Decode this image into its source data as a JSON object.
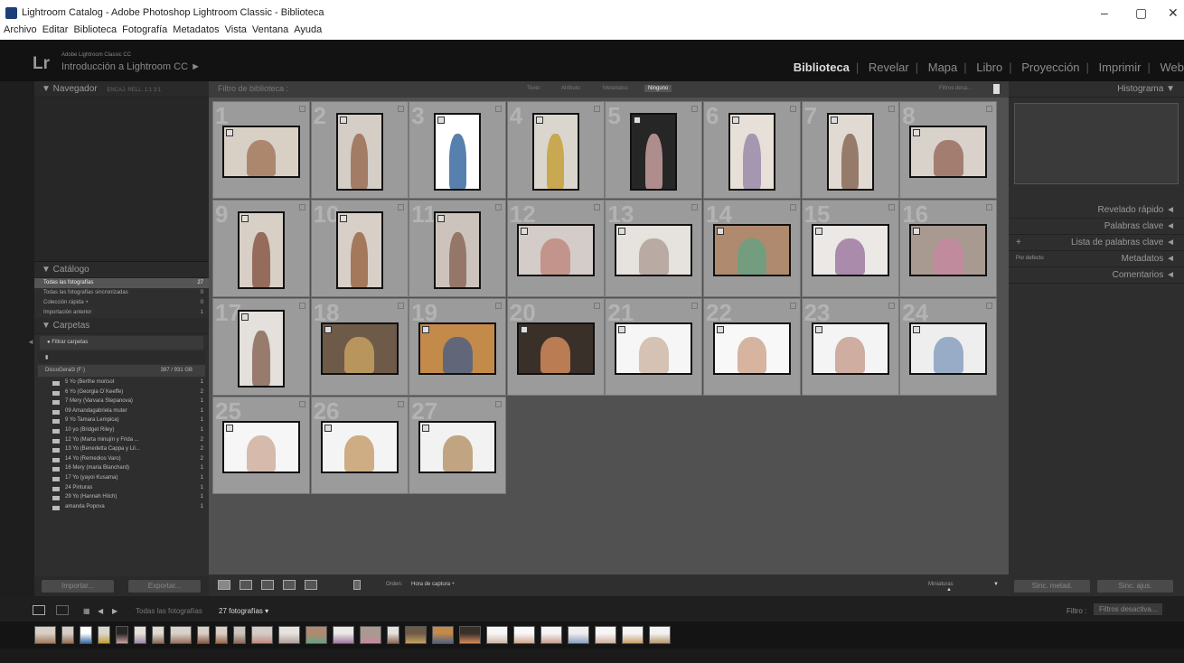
{
  "window": {
    "title": "Lightroom Catalog - Adobe Photoshop Lightroom Classic - Biblioteca",
    "min": "–",
    "max": "▢",
    "close": "✕"
  },
  "menu": [
    "Archivo",
    "Editar",
    "Biblioteca",
    "Fotografía",
    "Metadatos",
    "Vista",
    "Ventana",
    "Ayuda"
  ],
  "identity": {
    "logo": "Lr",
    "product_small": "Adobe Lightroom Classic CC",
    "product": "Introducción a Lightroom CC ►"
  },
  "modules": [
    "Biblioteca",
    "Revelar",
    "Mapa",
    "Libro",
    "Proyección",
    "Imprimir",
    "Web"
  ],
  "left": {
    "navigator": "▼ Navegador",
    "navigator_opts": "ENCAJ.  RELL.  1:1  3:1",
    "catalog": "▼ Catálogo",
    "catalog_items": [
      {
        "label": "Todas las fotografías",
        "count": "27"
      },
      {
        "label": "Todas las fotografías sincronizadas",
        "count": "0"
      },
      {
        "label": "Colección rápida +",
        "count": "0"
      },
      {
        "label": "Importación anterior",
        "count": "1"
      }
    ],
    "folders": "▼ Carpetas",
    "filter_folders": "Filtrar carpetas",
    "volume": "DiscoGeral3 (F:)",
    "volume_size": "387 / 931 GB",
    "folder_items": [
      {
        "label": "5 Yo (Berthe morisot",
        "count": "1"
      },
      {
        "label": "6 Yo (Georgia O´Keeffe)",
        "count": "2"
      },
      {
        "label": "7 Mery (Varvara Stepanova)",
        "count": "1"
      },
      {
        "label": "09 Amandagabriela muter",
        "count": "1"
      },
      {
        "label": "9 Yo Tamara Lempica)",
        "count": "1"
      },
      {
        "label": "10 yo (Bridget Riley)",
        "count": "1"
      },
      {
        "label": "12 Yo (Marta minujín y Frida ...",
        "count": "2"
      },
      {
        "label": "13 Yo (Benedetta Cappa y Lil...",
        "count": "2"
      },
      {
        "label": "14 Yo (Remedios Varo)",
        "count": "2"
      },
      {
        "label": "16 Mery (maria Blanchard)",
        "count": "1"
      },
      {
        "label": "17 Yo (yayoi Kusama)",
        "count": "1"
      },
      {
        "label": "24 Pinturas",
        "count": "1"
      },
      {
        "label": "29 Yo (Hannah Höch)",
        "count": "1"
      },
      {
        "label": "amanda Popova",
        "count": "1"
      }
    ],
    "import_btn": "Importar...",
    "export_btn": "Exportar..."
  },
  "filter": {
    "title": "Filtro de biblioteca :",
    "texto": "Texto",
    "atributo": "Atributo",
    "metadatos": "Metadatos",
    "ninguno": "Ninguno",
    "preset": "Filtros desa..."
  },
  "grid": {
    "numbers": [
      "1",
      "2",
      "3",
      "4",
      "5",
      "6",
      "7",
      "8",
      "9",
      "10",
      "11",
      "12",
      "13",
      "14",
      "15",
      "16",
      "17",
      "18",
      "19",
      "20",
      "21",
      "22",
      "23",
      "24",
      "25",
      "26",
      "27"
    ]
  },
  "toolbar": {
    "orden_label": "Orden:",
    "orden_value": "Hora de captura ÷",
    "miniaturas": "Miniaturas"
  },
  "right": {
    "histograma": "Histograma ▼",
    "panels": [
      "Revelado rápido ◄",
      "Palabras clave ◄",
      "Lista de palabras clave ◄",
      "Metadatos ◄",
      "Comentarios ◄"
    ],
    "metadata_preset": "Por defecto",
    "sync_meta": "Sinc. metad.",
    "sync_ajust": "Sinc. ajus."
  },
  "filmstrip": {
    "source": "Todas las fotografías",
    "count": "27 fotografías ▾",
    "filter_label": "Filtro :",
    "filter_value": "Filtros desactiva..."
  },
  "colors": {
    "accent": "#dddddd",
    "cell": "#9b9b9b",
    "bg": "#515151"
  }
}
